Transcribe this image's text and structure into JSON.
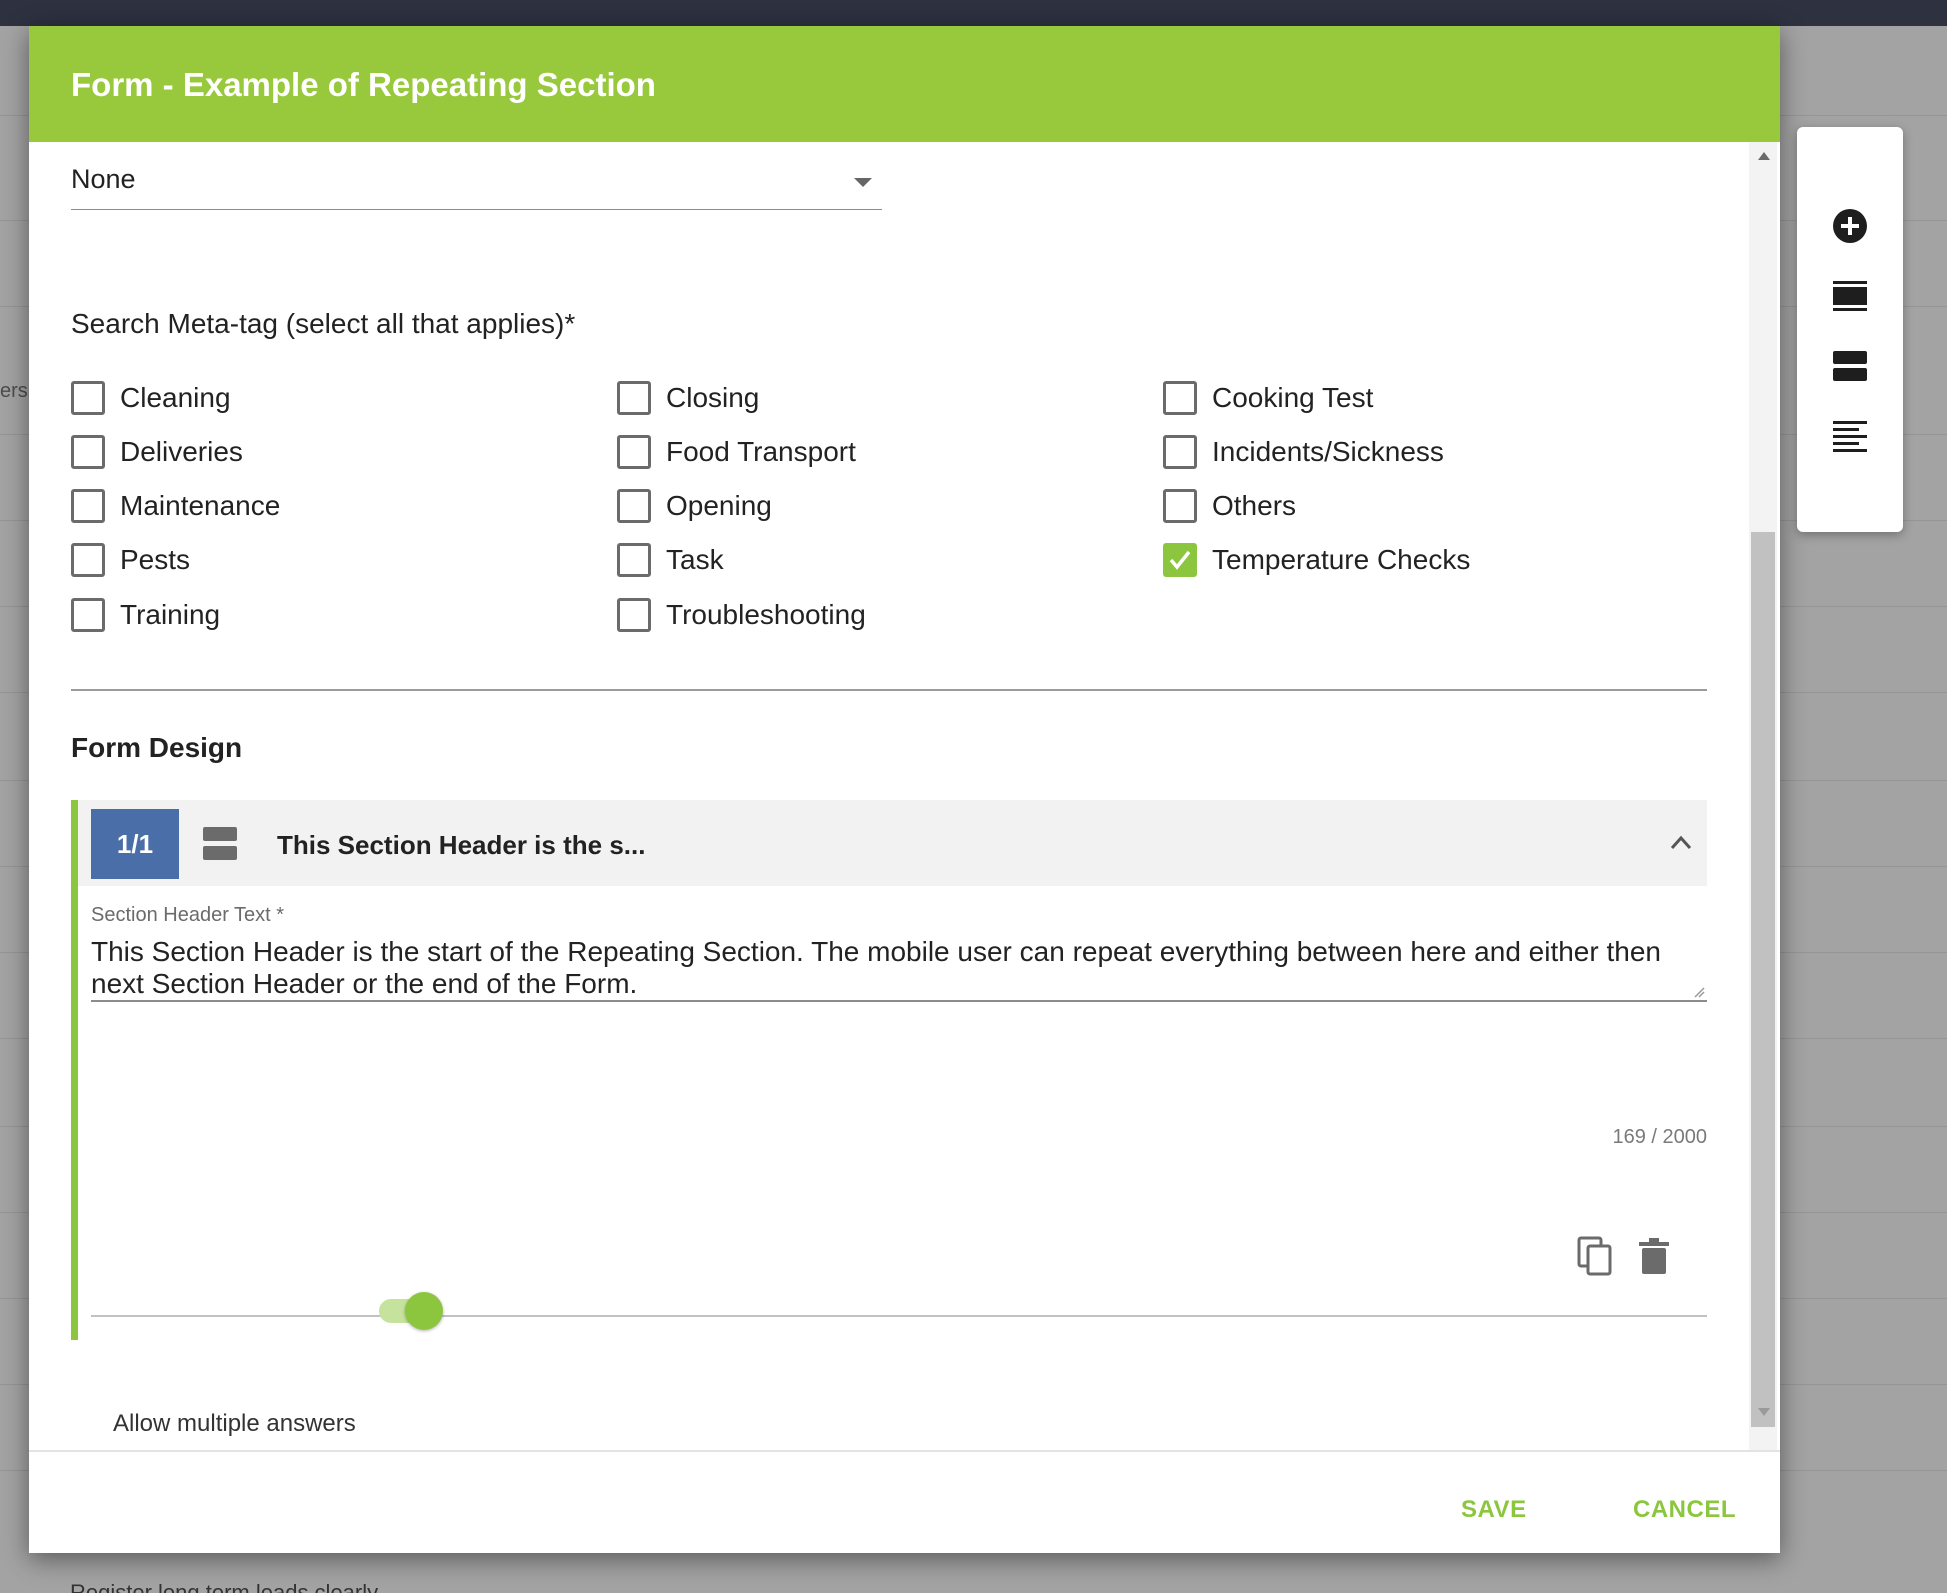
{
  "background": {
    "fragment_text": "ersi",
    "bottom_text": "Register long term leads clearly"
  },
  "dialog": {
    "title": "Form - Example of Repeating Section",
    "select": {
      "value": "None"
    },
    "meta_tag_label": "Search Meta-tag (select all that applies)*",
    "meta_tags": [
      {
        "label": "Cleaning",
        "checked": false
      },
      {
        "label": "Closing",
        "checked": false
      },
      {
        "label": "Cooking Test",
        "checked": false
      },
      {
        "label": "Deliveries",
        "checked": false
      },
      {
        "label": "Food Transport",
        "checked": false
      },
      {
        "label": "Incidents/Sickness",
        "checked": false
      },
      {
        "label": "Maintenance",
        "checked": false
      },
      {
        "label": "Opening",
        "checked": false
      },
      {
        "label": "Others",
        "checked": false
      },
      {
        "label": "Pests",
        "checked": false
      },
      {
        "label": "Task",
        "checked": false
      },
      {
        "label": "Temperature Checks",
        "checked": true
      },
      {
        "label": "Training",
        "checked": false
      },
      {
        "label": "Troubleshooting",
        "checked": false
      }
    ],
    "form_design_title": "Form Design",
    "section": {
      "badge": "1/1",
      "icon": "section-header-icon",
      "header_title": "This Section Header is the s...",
      "field_label": "Section Header Text *",
      "text": "This Section Header is the start of the Repeating Section. The mobile user can repeat everything between here and either then next Section Header or the end of the Form.",
      "char_count": "169 / 2000",
      "allow_multiple_label": "Allow multiple answers",
      "allow_multiple": true
    },
    "save_label": "SAVE",
    "cancel_label": "CANCEL"
  },
  "toolbar": {
    "items": [
      {
        "name": "add-circle-icon"
      },
      {
        "name": "section-icon"
      },
      {
        "name": "repeating-section-icon"
      },
      {
        "name": "text-align-icon"
      }
    ]
  },
  "colors": {
    "accent": "#8cc63f",
    "header_bg": "#98c93c",
    "badge": "#4a6fa8"
  }
}
